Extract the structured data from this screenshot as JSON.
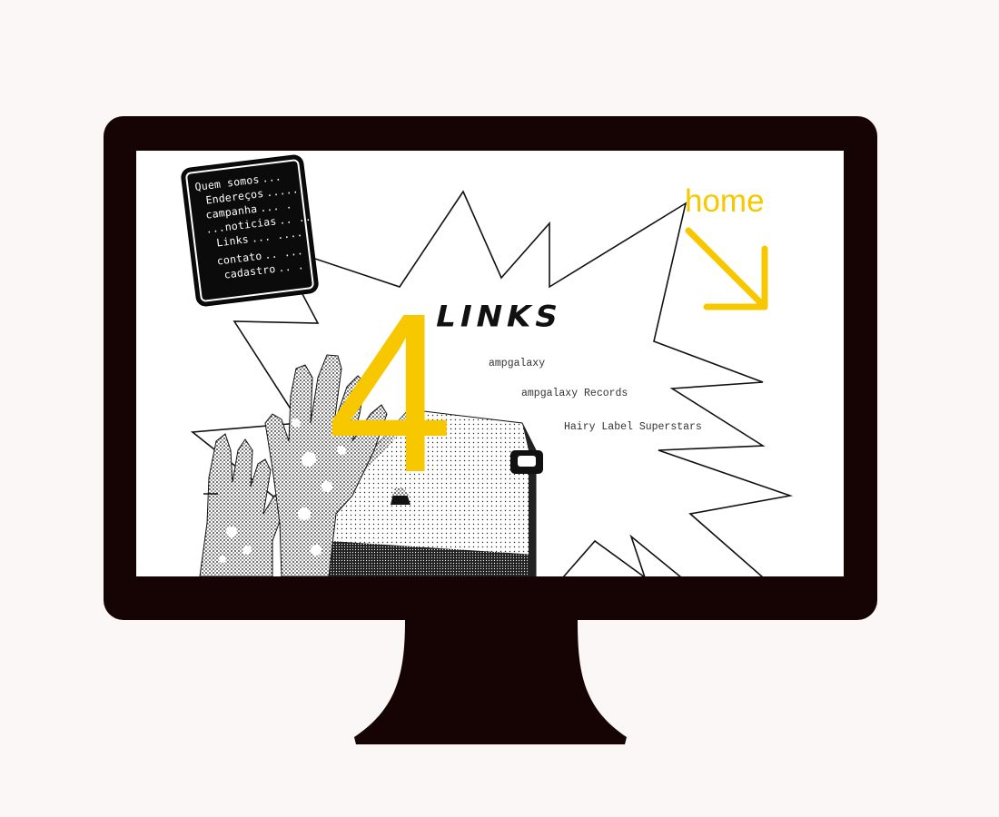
{
  "menu": {
    "items": [
      {
        "label": "Quem somos",
        "dots": "..."
      },
      {
        "label": "Endereços",
        "dots": "......"
      },
      {
        "label": "campanha",
        "dots": "... ."
      },
      {
        "label": "...noticias",
        "dots": ".. .."
      },
      {
        "label": "Links",
        "dots": "... ...."
      },
      {
        "label": "contato",
        "dots": ".. ..."
      },
      {
        "label": "cadastro",
        "dots": ".. ."
      }
    ]
  },
  "page": {
    "title": "LINKS",
    "number": "4"
  },
  "links": [
    {
      "label": "ampgalaxy"
    },
    {
      "label": "ampgalaxy Records"
    },
    {
      "label": "Hairy Label Superstars"
    }
  ],
  "home": {
    "label": "home",
    "icon": "arrow-down-right-icon",
    "color": "#f7c800"
  },
  "colors": {
    "accent": "#f7c800",
    "monitor": "#160405",
    "background": "#fbf7f6"
  }
}
